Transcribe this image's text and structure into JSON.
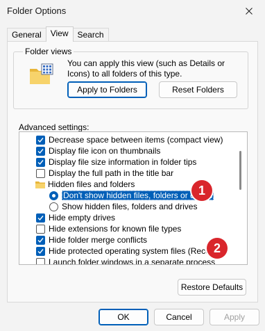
{
  "window": {
    "title": "Folder Options"
  },
  "tabs": [
    {
      "label": "General"
    },
    {
      "label": "View"
    },
    {
      "label": "Search"
    }
  ],
  "folder_views": {
    "group_label": "Folder views",
    "description": "You can apply this view (such as Details or Icons) to all folders of this type.",
    "apply_button": "Apply to Folders",
    "reset_button": "Reset Folders"
  },
  "advanced": {
    "label": "Advanced settings:",
    "items": [
      {
        "kind": "checkbox",
        "checked": true,
        "label": "Decrease space between items (compact view)"
      },
      {
        "kind": "checkbox",
        "checked": true,
        "label": "Display file icon on thumbnails"
      },
      {
        "kind": "checkbox",
        "checked": true,
        "label": "Display file size information in folder tips"
      },
      {
        "kind": "checkbox",
        "checked": false,
        "label": "Display the full path in the title bar"
      },
      {
        "kind": "folder",
        "label": "Hidden files and folders"
      },
      {
        "kind": "radio",
        "checked": true,
        "selected": true,
        "label": "Don't show hidden files, folders or drives"
      },
      {
        "kind": "radio",
        "checked": false,
        "label": "Show hidden files, folders and drives"
      },
      {
        "kind": "checkbox",
        "checked": true,
        "label": "Hide empty drives"
      },
      {
        "kind": "checkbox",
        "checked": false,
        "label": "Hide extensions for known file types"
      },
      {
        "kind": "checkbox",
        "checked": true,
        "label": "Hide folder merge conflicts"
      },
      {
        "kind": "checkbox",
        "checked": true,
        "label": "Hide protected operating system files (Recomme"
      },
      {
        "kind": "checkbox",
        "checked": false,
        "label": "Launch folder windows in a separate process"
      }
    ],
    "restore_button": "Restore Defaults"
  },
  "annotations": [
    "1",
    "2"
  ],
  "footer": {
    "ok": "OK",
    "cancel": "Cancel",
    "apply": "Apply"
  },
  "colors": {
    "accent": "#005fb8",
    "annotation": "#d9262c"
  }
}
